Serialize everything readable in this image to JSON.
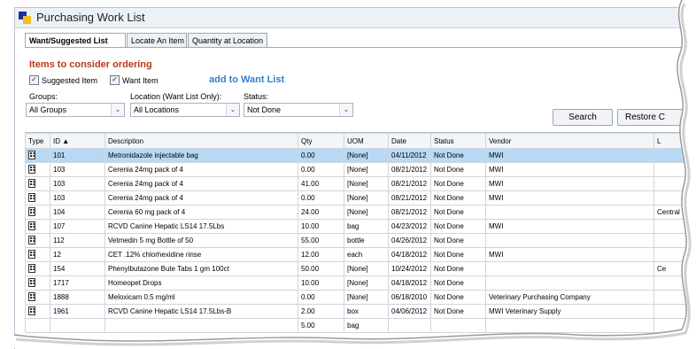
{
  "window": {
    "title": "Purchasing Work List"
  },
  "tabs": [
    {
      "label": "Want/Suggested List",
      "active": true
    },
    {
      "label": "Locate An Item",
      "active": false
    },
    {
      "label": "Quantity at Location",
      "active": false
    }
  ],
  "heading": "Items to consider ordering",
  "checkboxes": [
    {
      "label": "Suggested Item",
      "checked": true
    },
    {
      "label": "Want Item",
      "checked": true
    }
  ],
  "add_link": "add to Want List",
  "filters": {
    "groups": {
      "label": "Groups:",
      "value": "All Groups"
    },
    "location": {
      "label": "Location (Want List Only):",
      "value": "All Locations"
    },
    "status": {
      "label": "Status:",
      "value": "Not Done"
    }
  },
  "buttons": {
    "search": "Search",
    "restore": "Restore C"
  },
  "grid": {
    "columns": [
      "Type",
      "ID ▲",
      "Description",
      "Qty",
      "UOM",
      "Date",
      "Status",
      "Vendor",
      "L"
    ],
    "rows": [
      [
        "",
        "101",
        "Metronidazole injectable bag",
        "0.00",
        "[None]",
        "04/11/2012",
        "Not Done",
        "MWI",
        ""
      ],
      [
        "",
        "103",
        "Cerenia 24mg pack of 4",
        "0.00",
        "[None]",
        "08/21/2012",
        "Not Done",
        "MWI",
        ""
      ],
      [
        "",
        "103",
        "Cerenia 24mg pack of 4",
        "41.00",
        "[None]",
        "08/21/2012",
        "Not Done",
        "MWI",
        ""
      ],
      [
        "",
        "103",
        "Cerenia 24mg pack of 4",
        "0.00",
        "[None]",
        "08/21/2012",
        "Not Done",
        "MWI",
        ""
      ],
      [
        "",
        "104",
        "Cerenia 60 mg pack of 4",
        "24.00",
        "[None]",
        "08/21/2012",
        "Not Done",
        "",
        "Central"
      ],
      [
        "",
        "107",
        "RCVD Canine Hepatic LS14 17.5Lbs",
        "10.00",
        "bag",
        "04/23/2012",
        "Not Done",
        "MWI",
        ""
      ],
      [
        "",
        "112",
        "Vetmedin 5 mg Bottle of 50",
        "55.00",
        "bottle",
        "04/26/2012",
        "Not Done",
        "",
        ""
      ],
      [
        "",
        "12",
        "CET .12% chlorhexidine rinse",
        "12.00",
        "each",
        "04/18/2012",
        "Not Done",
        "MWI",
        ""
      ],
      [
        "",
        "154",
        "Phenylbutazone Bute Tabs 1 gm 100ct",
        "50.00",
        "[None]",
        "10/24/2012",
        "Not Done",
        "",
        "Ce"
      ],
      [
        "",
        "1717",
        "Homeopet Drops",
        "10.00",
        "[None]",
        "04/18/2012",
        "Not Done",
        "",
        ""
      ],
      [
        "",
        "1888",
        "Meloxicam 0.5 mg/ml",
        "0.00",
        "[None]",
        "06/18/2010",
        "Not Done",
        "Veterinary Purchasing Company",
        ""
      ],
      [
        "",
        "1961",
        "RCVD Canine Hepatic LS14 17.5Lbs-B",
        "2.00",
        "box",
        "04/06/2012",
        "Not Done",
        "MWI Veterinary Supply",
        ""
      ],
      [
        "",
        "",
        "",
        "5.00",
        "bag",
        "",
        "",
        "",
        ""
      ]
    ],
    "selected_row": 0
  },
  "colors": {
    "heading": "#b83a17",
    "link": "#2f7fd2",
    "selection": "#b7d9f4"
  }
}
